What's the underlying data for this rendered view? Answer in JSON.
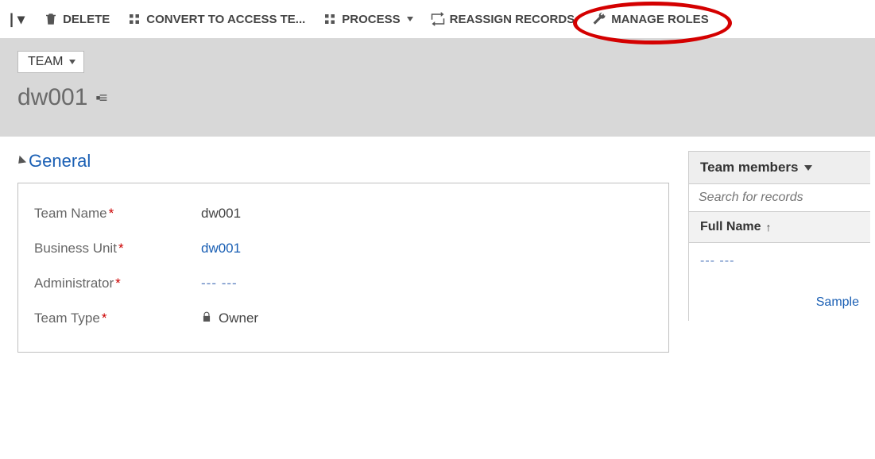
{
  "cmdbar": {
    "delete": "DELETE",
    "convert": "CONVERT TO ACCESS TE...",
    "process": "PROCESS",
    "reassign": "REASSIGN RECORDS",
    "manage_roles": "MANAGE ROLES"
  },
  "header": {
    "entity": "TEAM",
    "title": "dw001"
  },
  "section": {
    "general": "General"
  },
  "fields": {
    "team_name": {
      "label": "Team Name",
      "value": "dw001"
    },
    "business_unit": {
      "label": "Business Unit",
      "value": "dw001"
    },
    "administrator": {
      "label": "Administrator",
      "value": "--- ---"
    },
    "team_type": {
      "label": "Team Type",
      "value": "Owner"
    }
  },
  "side": {
    "title": "Team members",
    "search_placeholder": "Search for records",
    "col_fullname": "Full Name",
    "row_placeholder": "--- ---",
    "sample_link": "Sample"
  }
}
